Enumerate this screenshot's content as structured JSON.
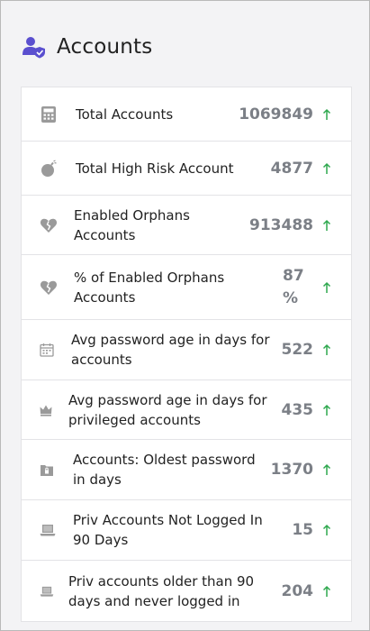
{
  "header": {
    "title": "Accounts",
    "icon": "user-shield-icon"
  },
  "trend_color": "#2fa84f",
  "accent_color": "#5a4fcf",
  "rows": [
    {
      "label_lines": [
        "Total Accounts"
      ],
      "value_lines": [
        "1069849"
      ],
      "icon": "calculator-icon"
    },
    {
      "label_lines": [
        "Total High Risk Account"
      ],
      "value_lines": [
        "4877"
      ],
      "icon": "bomb-icon"
    },
    {
      "label_lines": [
        "Enabled Orphans",
        "Accounts"
      ],
      "value_lines": [
        "913488"
      ],
      "icon": "broken-heart-icon"
    },
    {
      "label_lines": [
        "% of Enabled Orphans",
        "Accounts"
      ],
      "value_lines": [
        "87",
        "%"
      ],
      "icon": "broken-heart-icon"
    },
    {
      "label_lines": [
        "Avg password age in days for",
        "accounts"
      ],
      "value_lines": [
        "522"
      ],
      "icon": "calendar-icon"
    },
    {
      "label_lines": [
        "Avg password age in days for",
        "privileged accounts"
      ],
      "value_lines": [
        "435"
      ],
      "icon": "crown-icon"
    },
    {
      "label_lines": [
        "Accounts: Oldest password",
        "in days"
      ],
      "value_lines": [
        "1370"
      ],
      "icon": "lock-folder-icon"
    },
    {
      "label_lines": [
        "Priv Accounts Not Logged In",
        "90 Days"
      ],
      "value_lines": [
        "15"
      ],
      "icon": "laptop-icon"
    },
    {
      "label_lines": [
        "Priv accounts older than 90",
        "days and never logged in"
      ],
      "value_lines": [
        "204"
      ],
      "icon": "laptop-icon"
    }
  ]
}
